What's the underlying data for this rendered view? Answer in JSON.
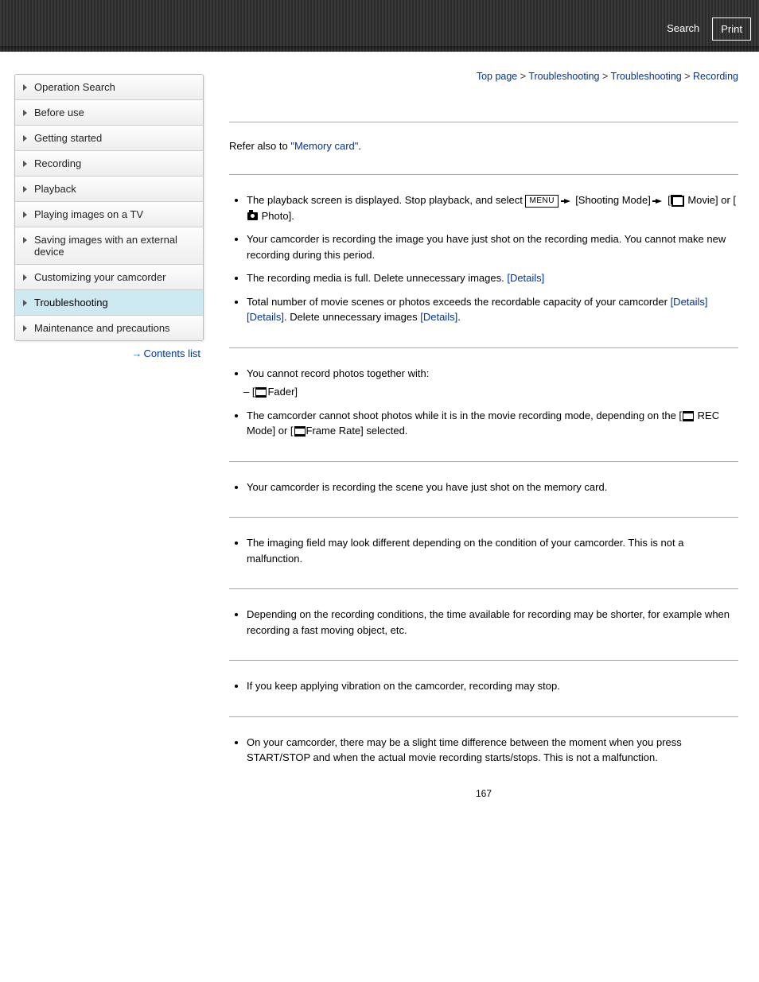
{
  "banner": {
    "search": "Search",
    "print": "Print"
  },
  "breadcrumb": {
    "top": "Top page",
    "c1": "Troubleshooting",
    "c2": "Troubleshooting",
    "c3": "Recording",
    "sep": ">"
  },
  "sidebar": {
    "items": [
      {
        "label": "Operation Search",
        "active": false
      },
      {
        "label": "Before use",
        "active": false
      },
      {
        "label": "Getting started",
        "active": false
      },
      {
        "label": "Recording",
        "active": false
      },
      {
        "label": "Playback",
        "active": false
      },
      {
        "label": "Playing images on a TV",
        "active": false
      },
      {
        "label": "Saving images with an external device",
        "active": false
      },
      {
        "label": "Customizing your camcorder",
        "active": false
      },
      {
        "label": "Troubleshooting",
        "active": true
      },
      {
        "label": "Maintenance and precautions",
        "active": false
      }
    ],
    "contents_link": "Contents list"
  },
  "intro": {
    "prefix": "Refer also to ",
    "link": "\"Memory card\"",
    "suffix": "."
  },
  "sec1": {
    "i0a": "The playback screen is displayed. Stop playback, and select ",
    "menu": "MENU",
    "i0b": " [Shooting Mode] ",
    "i0c": " [",
    "i0d": " Movie] or [",
    "i0e": " Photo].",
    "i1": "Your camcorder is recording the image you have just shot on the recording media. You cannot make new recording during this period.",
    "i2a": "The recording media is full. Delete unnecessary images. ",
    "i2link": "[Details]",
    "i3a": "Total number of movie scenes or photos exceeds the recordable capacity of your camcorder ",
    "i3link1": "[Details]",
    "i3link2": "[Details]",
    "i3b": ". Delete unnecessary images ",
    "i3link3": "[Details]",
    "i3c": "."
  },
  "sec2": {
    "i0": "You cannot record photos together with:",
    "i0sub": "Fader]",
    "i0subpre": "[",
    "i1a": "The camcorder cannot shoot photos while it is in the movie recording mode, depending on the [",
    "i1b": " REC Mode] or [",
    "i1c": "Frame Rate] selected."
  },
  "sec3": {
    "i0": "Your camcorder is recording the scene you have just shot on the memory card."
  },
  "sec4": {
    "i0": "The imaging field may look different depending on the condition of your camcorder. This is not a malfunction."
  },
  "sec5": {
    "i0": "Depending on the recording conditions, the time available for recording may be shorter, for example when recording a fast moving object, etc."
  },
  "sec6": {
    "i0": "If you keep applying vibration on the camcorder, recording may stop."
  },
  "sec7": {
    "i0": "On your camcorder, there may be a slight time difference between the moment when you press START/STOP and when the actual movie recording starts/stops. This is not a malfunction."
  },
  "page": "167"
}
